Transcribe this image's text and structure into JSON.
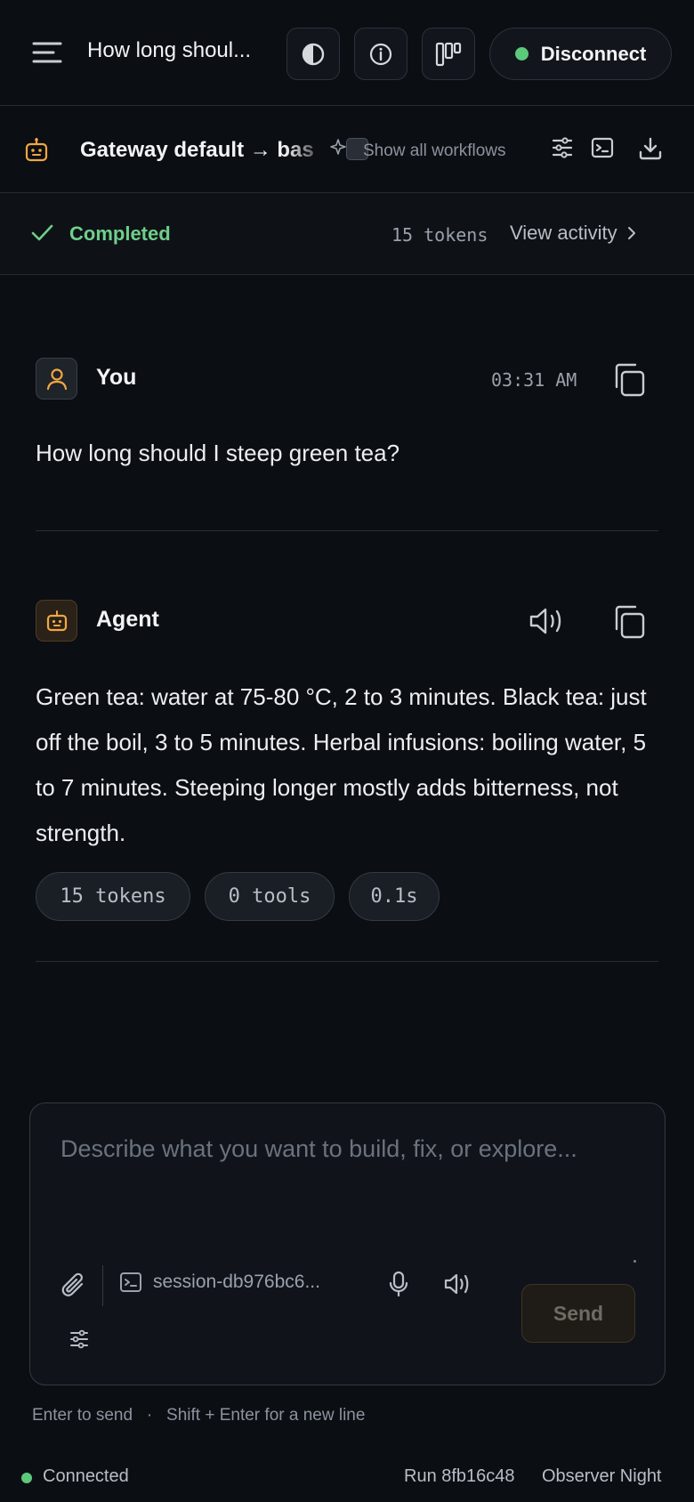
{
  "header": {
    "chat_title": "How long shoul...",
    "disconnect_label": "Disconnect",
    "connection_color": "#5cc97a",
    "icons": [
      "menu-icon",
      "contrast-icon",
      "info-icon",
      "kanban-icon"
    ]
  },
  "gateway": {
    "route_label": "Gateway default → bas",
    "show_all_label": "Show all workflows",
    "icons": [
      "bot-icon",
      "sparkle-icon",
      "sliders-icon",
      "terminal-icon",
      "download-icon"
    ]
  },
  "status": {
    "label": "Completed",
    "tokens": "15 tokens",
    "view_activity": "View activity",
    "accent": "#6fcf8a"
  },
  "messages": {
    "user": {
      "name": "You",
      "time": "03:31 AM",
      "text": "How long should I steep green tea?"
    },
    "agent": {
      "name": "Agent",
      "text": "Green tea: water at 75-80 °C, 2 to 3 minutes. Black tea: just off the boil, 3 to 5 minutes. Herbal infusions: boiling water, 5 to 7 minutes. Steeping longer mostly adds bitterness, not strength.",
      "chips": {
        "tokens": "15 tokens",
        "tools": "0 tools",
        "duration": "0.1s"
      }
    }
  },
  "composer": {
    "placeholder": "Describe what you want to build, fix, or explore...",
    "session_label": "session-db976bc6...",
    "send_label": "Send"
  },
  "hint": {
    "enter": "Enter to send",
    "separator": "·",
    "shift_enter": "Shift + Enter for a new line"
  },
  "footer": {
    "connection": "Connected",
    "run": "Run 8fb16c48",
    "theme": "Observer Night"
  }
}
